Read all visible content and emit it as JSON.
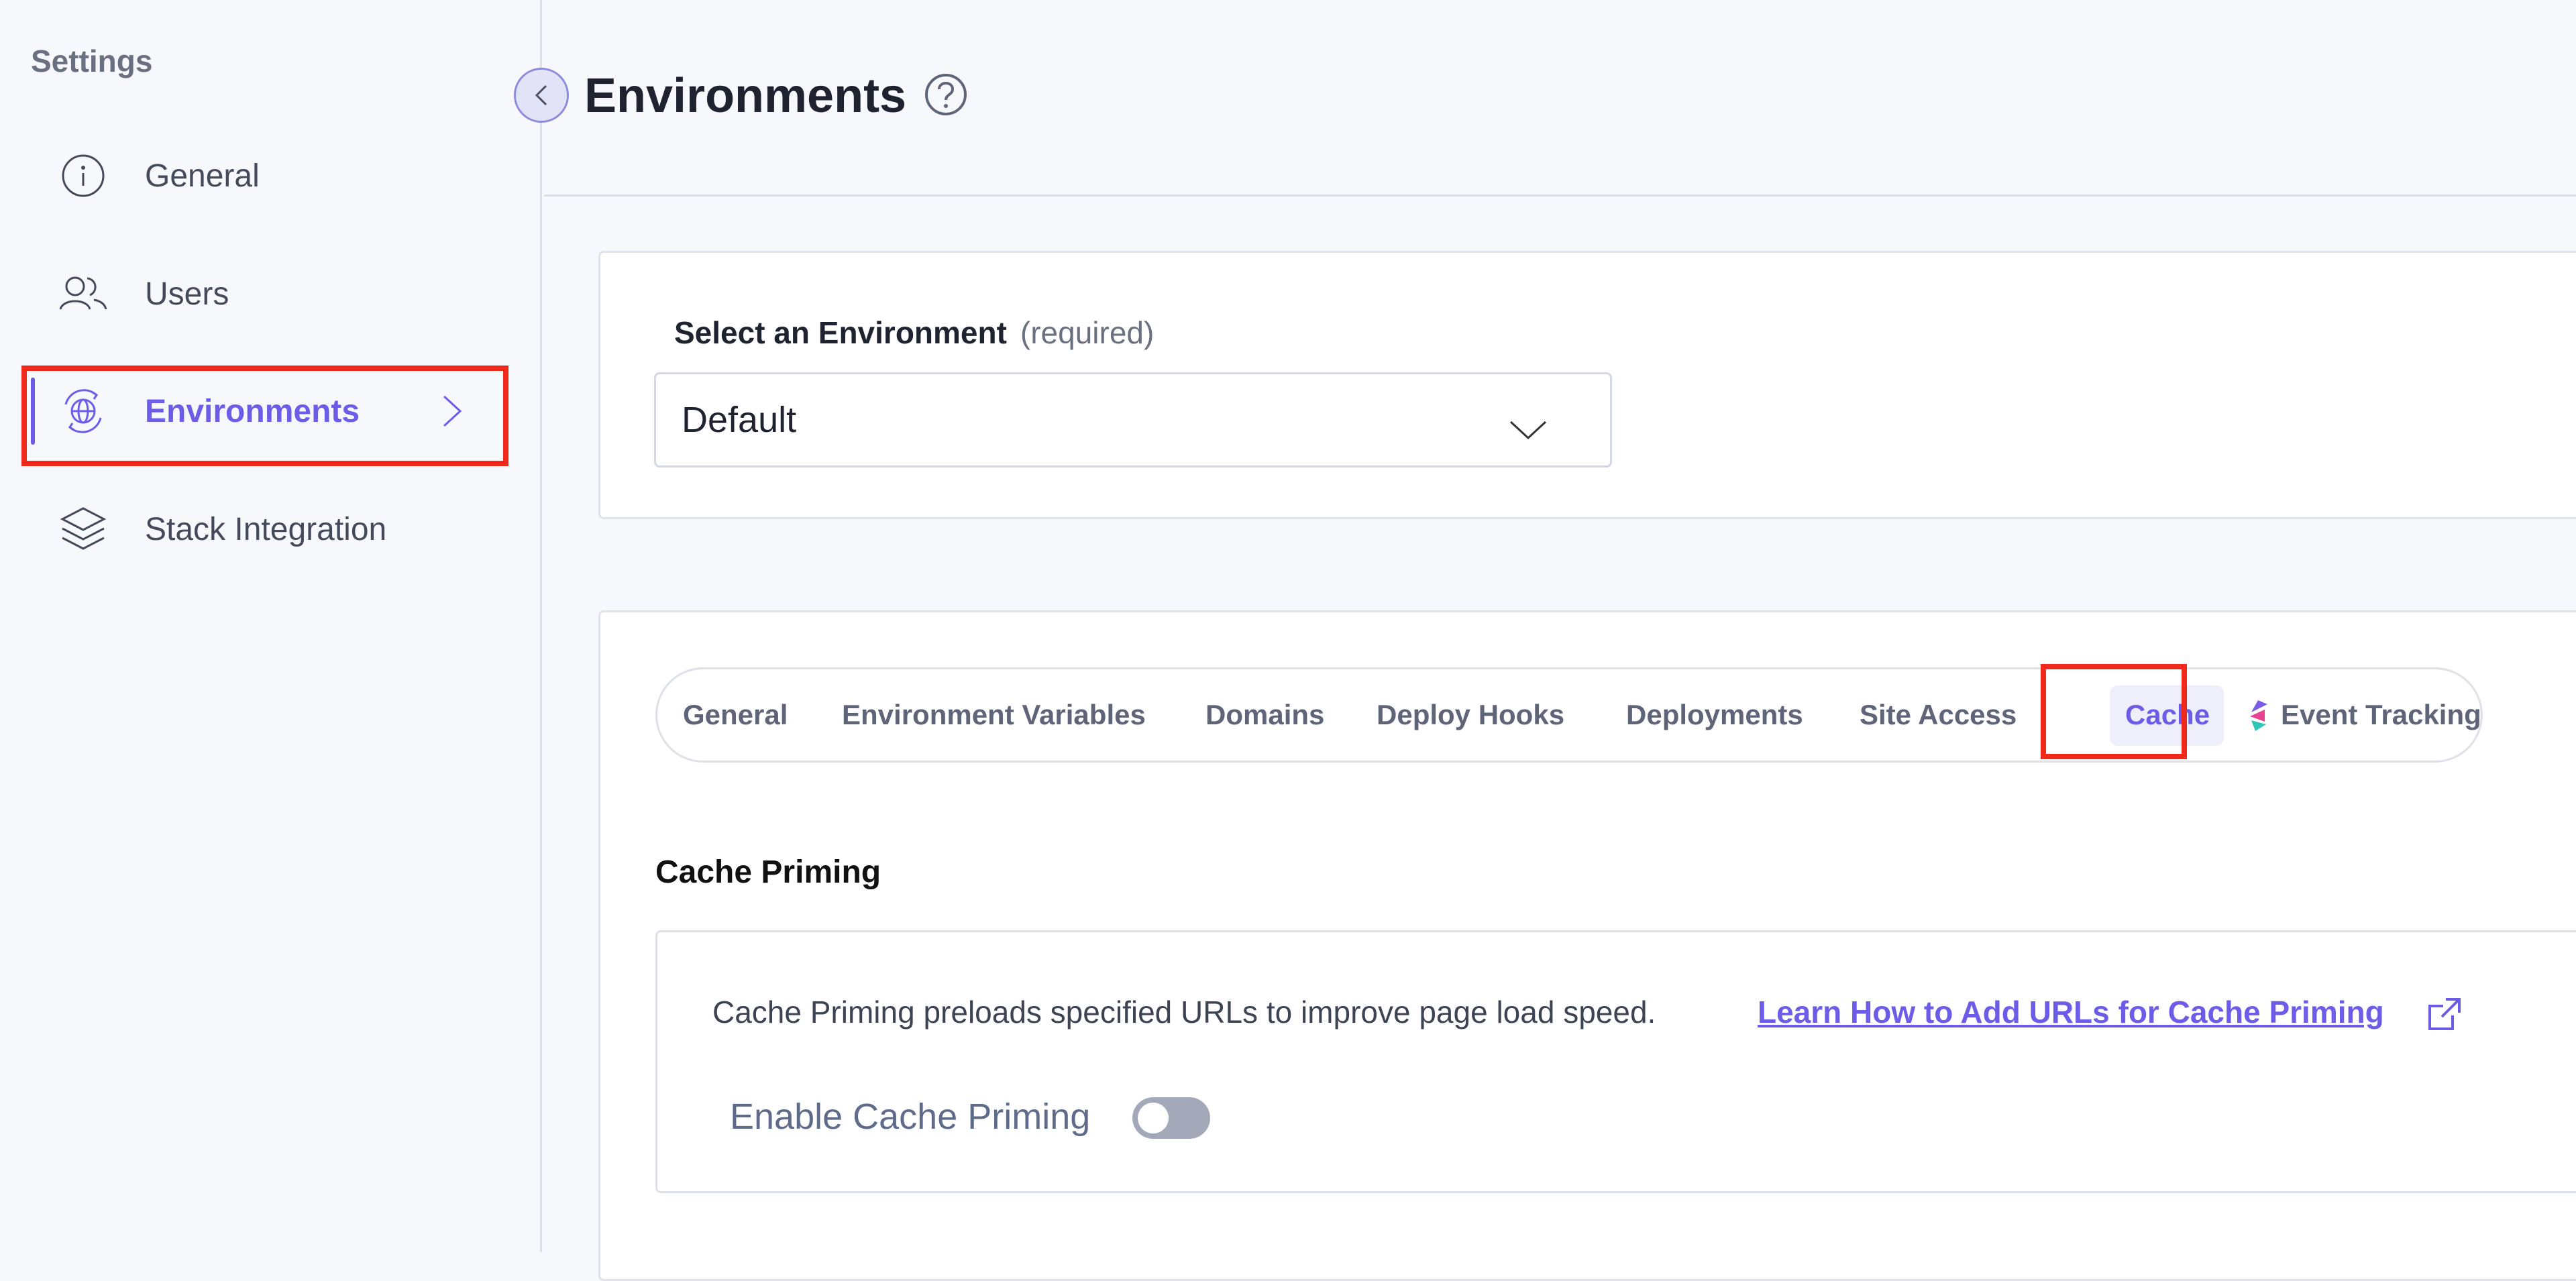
{
  "sidebar": {
    "title": "Settings",
    "items": [
      {
        "label": "General",
        "icon": "info-icon"
      },
      {
        "label": "Users",
        "icon": "users-icon"
      },
      {
        "label": "Environments",
        "icon": "globe-sync-icon",
        "active": true
      },
      {
        "label": "Stack Integration",
        "icon": "layers-icon"
      }
    ]
  },
  "header": {
    "title": "Environments"
  },
  "environment_select": {
    "label": "Select an Environment",
    "required_note": "(required)",
    "value": "Default"
  },
  "tabs": [
    {
      "label": "General"
    },
    {
      "label": "Environment Variables"
    },
    {
      "label": "Domains"
    },
    {
      "label": "Deploy Hooks"
    },
    {
      "label": "Deployments"
    },
    {
      "label": "Site Access"
    },
    {
      "label": "Cache",
      "active": true
    },
    {
      "label": "Event Tracking",
      "icon": "lytics-logo-icon"
    }
  ],
  "cache": {
    "section_title": "Cache Priming",
    "description": "Cache Priming preloads specified URLs to improve page load speed.",
    "link_text": "Learn How to Add URLs for Cache Priming",
    "toggle_label": "Enable Cache Priming",
    "toggle_enabled": false
  },
  "colors": {
    "accent": "#6c5ce7",
    "highlight": "#f0291a",
    "toggle_off": "#a3a9b8"
  }
}
